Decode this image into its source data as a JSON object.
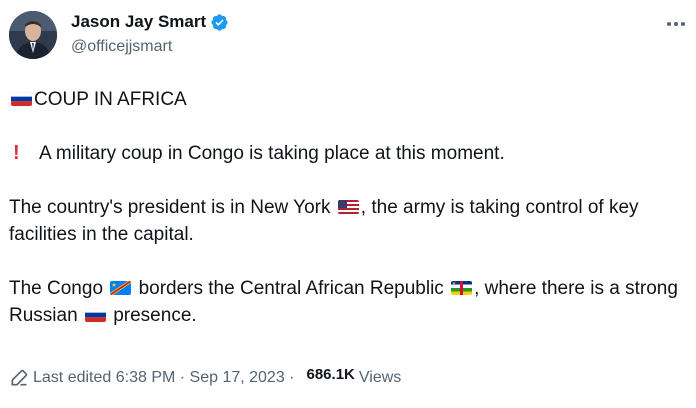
{
  "author": {
    "name": "Jason Jay Smart",
    "handle": "@officejjsmart"
  },
  "tweet": {
    "line1": "COUP IN AFRICA",
    "line2": "A military coup in Congo is taking place at this moment.",
    "line3a": "The country's president is in New York",
    "line3b": ", the army is taking control of key facilities in the capital.",
    "line4a": "The Congo",
    "line4b": "borders the Central African Republic",
    "line4c": ", where there is a strong Russian",
    "line4d": "presence."
  },
  "meta": {
    "edited": "Last edited 6:38 PM · Sep 17, 2023 ·",
    "views_count": "686.1K",
    "views_label": "Views"
  },
  "icons": {
    "verified": "verified-badge-icon",
    "more": "more-options-icon",
    "edit": "pencil-icon"
  },
  "colors": {
    "verified_blue": "#1d9bf0",
    "text": "#0f1419",
    "secondary": "#536471",
    "exclaim": "#dd2e44"
  }
}
